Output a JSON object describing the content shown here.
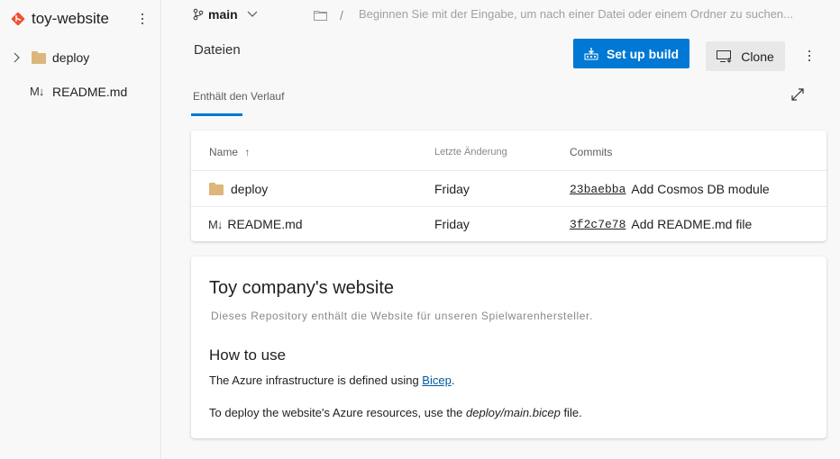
{
  "sidebar": {
    "repo_name": "toy-website",
    "tree": [
      {
        "type": "folder",
        "name": "deploy",
        "icon": "folder-icon",
        "expandable": true
      },
      {
        "type": "file",
        "name": "README.md",
        "icon_text": "M↓"
      }
    ]
  },
  "topbar": {
    "branch": "main",
    "path_separator": "/",
    "search_placeholder": "Beginnen Sie mit der Eingabe, um nach einer Datei oder einem Ordner zu suchen..."
  },
  "header": {
    "title": "Dateien",
    "setup_build_label": "Set up build",
    "clone_label": "Clone",
    "tab_history": "Enthält den Verlauf"
  },
  "files_table": {
    "columns": {
      "name": "Name",
      "sort_indicator": "↑",
      "changed": "Letzte Änderung",
      "commits": "Commits"
    },
    "rows": [
      {
        "name": "deploy",
        "type": "folder",
        "changed": "Friday",
        "hash": "23baebba",
        "message": "Add Cosmos DB module"
      },
      {
        "name": "README.md",
        "type": "file",
        "icon_text": "M↓",
        "changed": "Friday",
        "hash": "3f2c7e78",
        "message": "Add README.md file"
      }
    ]
  },
  "readme": {
    "title": "Toy company's website",
    "description": "Dieses Repository enthält die Website für unseren Spielwarenhersteller.",
    "heading": "How to use",
    "p1_before": "The Azure infrastructure is defined using ",
    "p1_link": "Bicep",
    "p1_after": ".",
    "p2_before": "To deploy the website's Azure resources, use the ",
    "p2_em": "deploy/main.bicep",
    "p2_after": " file."
  },
  "colors": {
    "accent": "#0078d4",
    "folder": "#dcb67a",
    "git": "#f05133"
  }
}
